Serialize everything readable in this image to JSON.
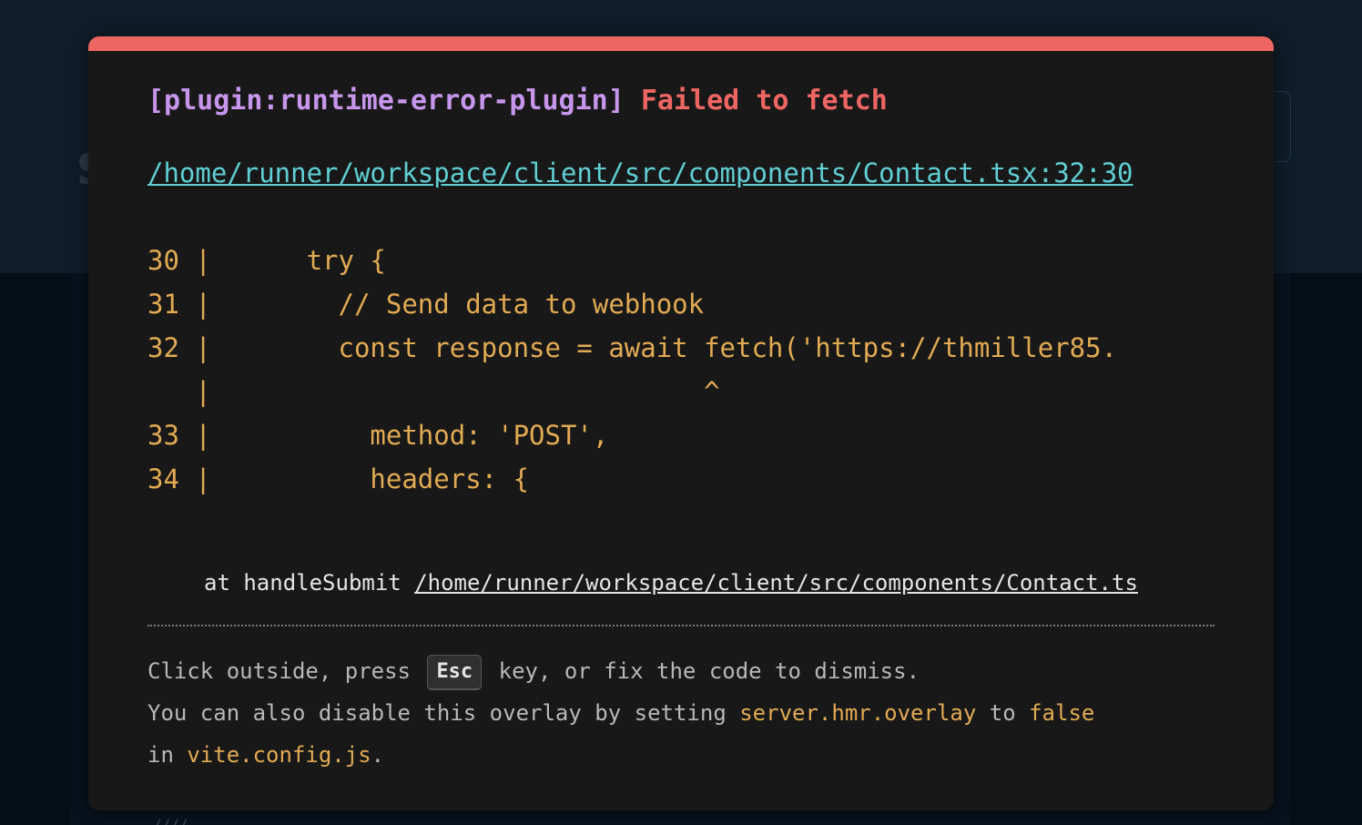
{
  "background": {
    "partial_letter": "s",
    "bottom_text": "////"
  },
  "overlay": {
    "accent_color": "#ee6662",
    "plugin": "[plugin:runtime-error-plugin]",
    "message": "Failed to fetch",
    "file": "/home/runner/workspace/client/src/components/Contact.tsx:32:30",
    "frame_lines": [
      "30 |      try {",
      "31 |        // Send data to webhook",
      "32 |        const response = await fetch('https://thmiller85.",
      "   |                               ^",
      "33 |          method: 'POST',",
      "34 |          headers: {"
    ],
    "stack": {
      "prefix": "at handleSubmit ",
      "link": "/home/runner/workspace/client/src/components/Contact.ts"
    },
    "tip": {
      "line1_before": "Click outside, press",
      "key": "Esc",
      "line1_after": "key, or fix the code to dismiss.",
      "line2_before": "You can also disable this overlay by setting ",
      "config_key": "server.hmr.overlay",
      "line2_mid": " to ",
      "config_value": "false",
      "line3_before": "in ",
      "config_file": "vite.config.js",
      "line3_after": "."
    }
  }
}
